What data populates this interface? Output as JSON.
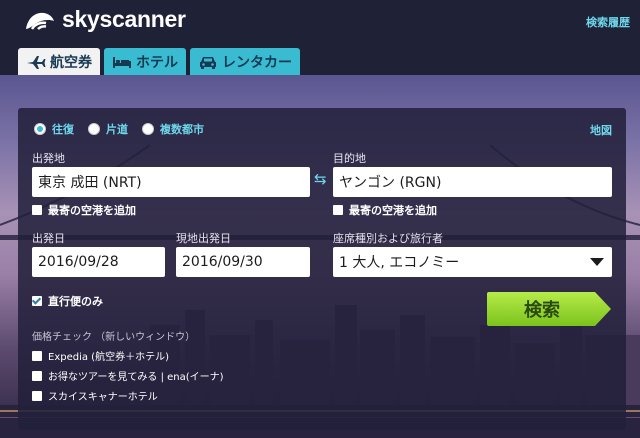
{
  "brand": {
    "name": "skyscanner"
  },
  "header": {
    "history_link": "検索履歴"
  },
  "tabs": [
    {
      "label": "航空券",
      "icon": "airplane-icon",
      "active": true
    },
    {
      "label": "ホテル",
      "icon": "bed-icon",
      "active": false
    },
    {
      "label": "レンタカー",
      "icon": "car-icon",
      "active": false
    }
  ],
  "trip_type": {
    "options": [
      {
        "label": "往復",
        "checked": true
      },
      {
        "label": "片道",
        "checked": false
      },
      {
        "label": "複数都市",
        "checked": false
      }
    ]
  },
  "map_link": "地図",
  "origin": {
    "label": "出発地",
    "value": "東京 成田 (NRT)",
    "nearby_label": "最寄の空港を追加",
    "nearby_checked": false
  },
  "destination": {
    "label": "目的地",
    "value": "ヤンゴン (RGN)",
    "nearby_label": "最寄の空港を追加",
    "nearby_checked": false
  },
  "depart": {
    "label": "出発日",
    "value": "2016/09/28"
  },
  "return": {
    "label": "現地出発日",
    "value": "2016/09/30"
  },
  "cabin": {
    "label": "座席種別および旅行者",
    "value": "1 大人, エコノミー"
  },
  "direct_only": {
    "label": "直行便のみ",
    "checked": true
  },
  "search_button": "検索",
  "price_check": {
    "title": "価格チェック （新しいウィンドウ）",
    "items": [
      {
        "label": "Expedia (航空券＋ホテル)",
        "checked": false
      },
      {
        "label": "お得なツアーを見てみる | ena(イーナ)",
        "checked": false
      },
      {
        "label": "スカイスキャナーホテル",
        "checked": false
      }
    ]
  },
  "colors": {
    "accent": "#39bcd1",
    "link": "#6ed7ea",
    "search_green": "#8ed12a",
    "header_bg": "#1f2137"
  }
}
